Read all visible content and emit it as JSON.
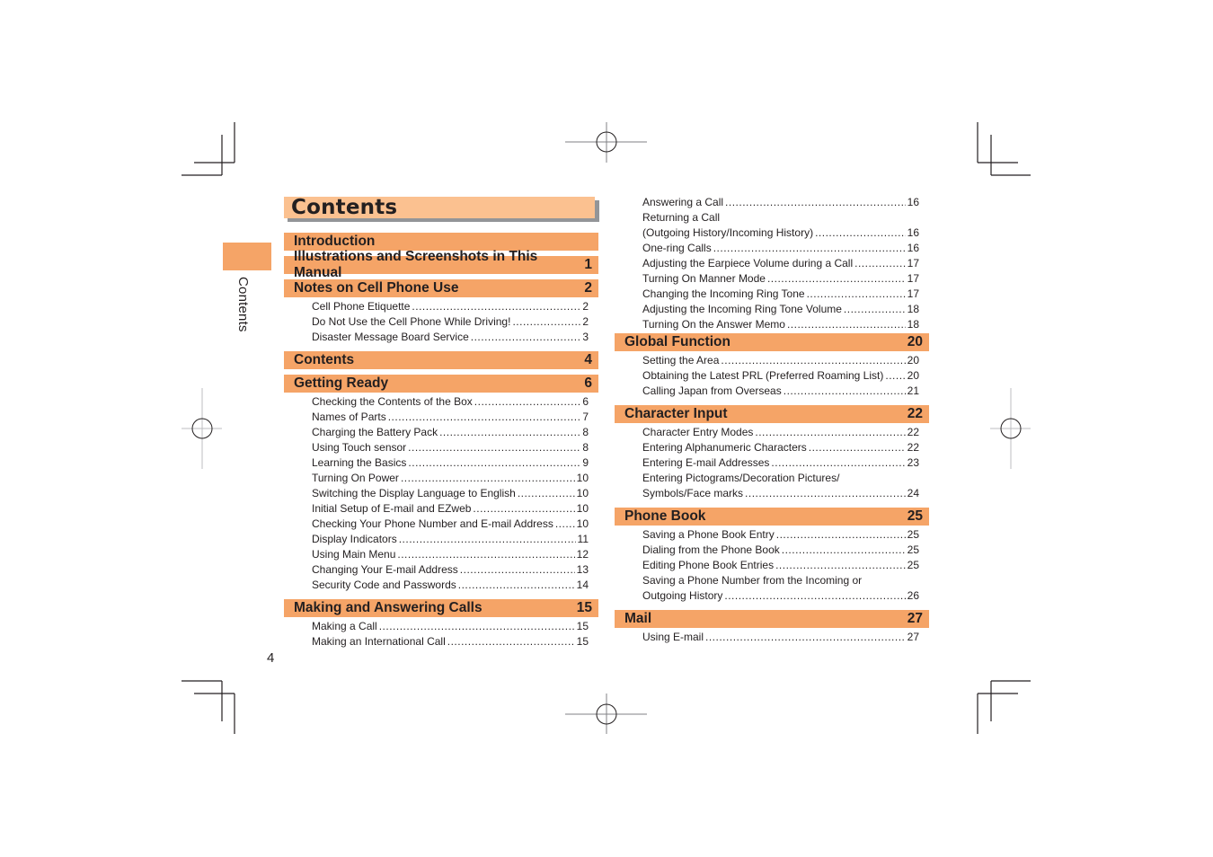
{
  "side": {
    "label": "Contents",
    "page_number": "4"
  },
  "title": "Contents",
  "colors": {
    "section_bar": "#f5a467",
    "title_bar": "#fbc190",
    "title_shadow": "#939598",
    "text": "#231f20"
  },
  "left_column": [
    {
      "section": "Introduction",
      "page": "",
      "items": []
    },
    {
      "section": "Illustrations and Screenshots in This Manual",
      "page": "1",
      "items": []
    },
    {
      "section": "Notes on Cell Phone Use",
      "page": "2",
      "items": [
        {
          "label": "Cell Phone Etiquette",
          "page": "2"
        },
        {
          "label": "Do Not Use the Cell Phone While Driving!",
          "page": "2"
        },
        {
          "label": "Disaster Message Board Service",
          "page": "3"
        }
      ]
    },
    {
      "section": "Contents",
      "page": "4",
      "items": []
    },
    {
      "section": "Getting Ready",
      "page": "6",
      "items": [
        {
          "label": "Checking the Contents of the Box",
          "page": "6"
        },
        {
          "label": "Names of Parts",
          "page": "7"
        },
        {
          "label": "Charging the Battery Pack",
          "page": "8"
        },
        {
          "label": "Using Touch sensor",
          "page": "8"
        },
        {
          "label": "Learning the Basics",
          "page": "9"
        },
        {
          "label": "Turning On Power",
          "page": "10"
        },
        {
          "label": "Switching the Display Language to English",
          "page": "10"
        },
        {
          "label": "Initial Setup of E-mail and EZweb",
          "page": "10"
        },
        {
          "label": "Checking Your Phone Number and E-mail Address",
          "page": "10"
        },
        {
          "label": "Display Indicators",
          "page": "11"
        },
        {
          "label": "Using Main Menu",
          "page": "12"
        },
        {
          "label": "Changing Your E-mail Address",
          "page": "13"
        },
        {
          "label": "Security Code and Passwords",
          "page": "14"
        }
      ]
    },
    {
      "section": "Making and Answering Calls",
      "page": "15",
      "items": [
        {
          "label": "Making a Call",
          "page": "15"
        },
        {
          "label": "Making an International Call",
          "page": "15"
        }
      ]
    }
  ],
  "right_column_continued": [
    {
      "label": "Answering a Call",
      "page": "16"
    },
    {
      "label": "Returning a Call",
      "page": ""
    },
    {
      "label": "(Outgoing History/Incoming History)",
      "page": "16"
    },
    {
      "label": "One-ring Calls",
      "page": "16"
    },
    {
      "label": "Adjusting the Earpiece Volume during a Call",
      "page": "17"
    },
    {
      "label": "Turning On Manner Mode",
      "page": "17"
    },
    {
      "label": "Changing the Incoming Ring Tone",
      "page": "17"
    },
    {
      "label": "Adjusting the Incoming Ring Tone Volume",
      "page": "18"
    },
    {
      "label": "Turning On the Answer Memo",
      "page": "18"
    }
  ],
  "right_column": [
    {
      "section": "Global Function",
      "page": "20",
      "items": [
        {
          "label": "Setting the Area",
          "page": "20"
        },
        {
          "label": "Obtaining the Latest PRL (Preferred Roaming List)",
          "page": "20"
        },
        {
          "label": "Calling Japan from Overseas",
          "page": "21"
        }
      ]
    },
    {
      "section": "Character Input",
      "page": "22",
      "items": [
        {
          "label": "Character Entry Modes",
          "page": "22"
        },
        {
          "label": "Entering Alphanumeric Characters",
          "page": "22"
        },
        {
          "label": "Entering E-mail Addresses",
          "page": "23"
        },
        {
          "label": "Entering Pictograms/Decoration Pictures/",
          "page": ""
        },
        {
          "label": "Symbols/Face marks",
          "page": "24"
        }
      ]
    },
    {
      "section": "Phone Book",
      "page": "25",
      "items": [
        {
          "label": "Saving a Phone Book Entry",
          "page": "25"
        },
        {
          "label": "Dialing from the Phone Book",
          "page": "25"
        },
        {
          "label": "Editing Phone Book Entries",
          "page": "25"
        },
        {
          "label": "Saving a Phone Number from the Incoming or",
          "page": ""
        },
        {
          "label": "Outgoing History",
          "page": "26"
        }
      ]
    },
    {
      "section": "Mail",
      "page": "27",
      "items": [
        {
          "label": "Using E-mail",
          "page": "27"
        }
      ]
    }
  ]
}
